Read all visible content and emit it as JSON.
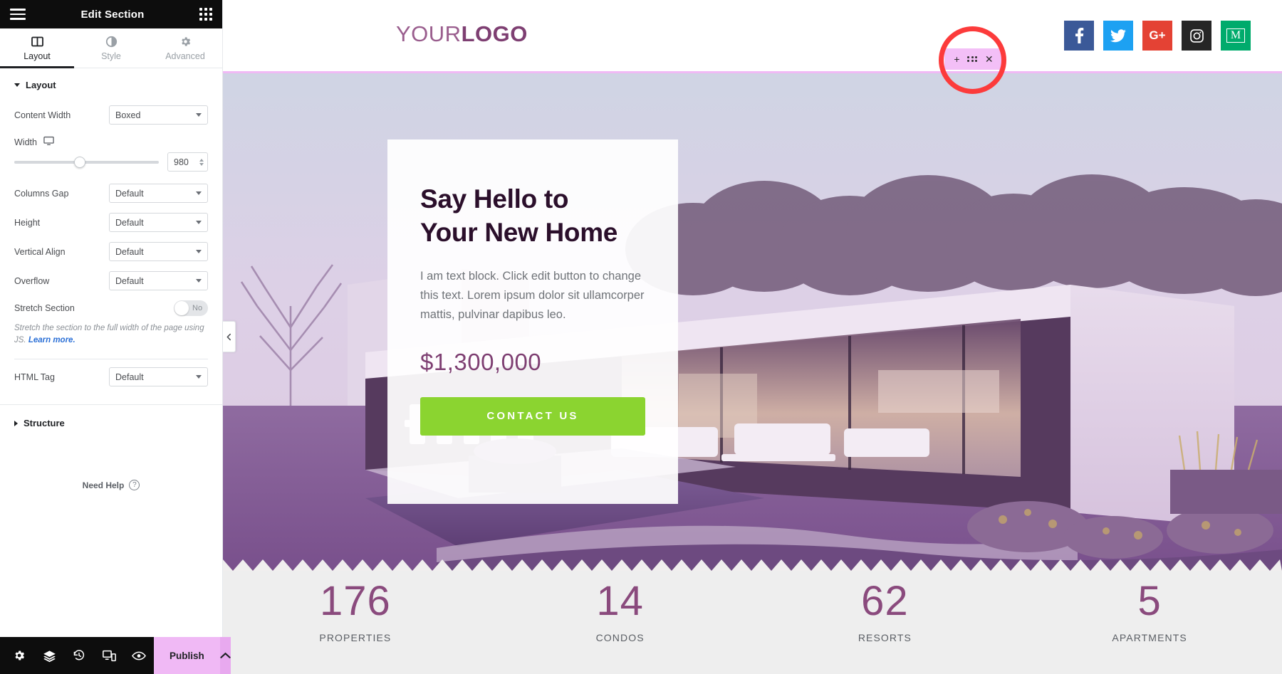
{
  "panel": {
    "header": {
      "title": "Edit Section",
      "menu_icon": "hamburger-icon",
      "widgets_icon": "grid-dots-icon"
    },
    "tabs": [
      {
        "label": "Layout",
        "icon": "layout-columns-icon",
        "active": true
      },
      {
        "label": "Style",
        "icon": "contrast-circle-icon",
        "active": false
      },
      {
        "label": "Advanced",
        "icon": "gear-icon",
        "active": false
      }
    ],
    "sections": {
      "layout": {
        "title": "Layout",
        "expanded": true,
        "controls": [
          {
            "label": "Content Width",
            "type": "select",
            "value": "Boxed"
          },
          {
            "label": "Width",
            "type": "slider",
            "value": "980",
            "device_icon": "desktop-icon"
          },
          {
            "label": "Columns Gap",
            "type": "select",
            "value": "Default"
          },
          {
            "label": "Height",
            "type": "select",
            "value": "Default"
          },
          {
            "label": "Vertical Align",
            "type": "select",
            "value": "Default"
          },
          {
            "label": "Overflow",
            "type": "select",
            "value": "Default"
          },
          {
            "label": "Stretch Section",
            "type": "toggle",
            "value": "No"
          },
          {
            "label": "HTML Tag",
            "type": "select",
            "value": "Default"
          }
        ],
        "hint_text": "Stretch the section to the full width of the page using JS. ",
        "hint_link": "Learn more."
      },
      "structure": {
        "title": "Structure",
        "expanded": false
      }
    },
    "need_help": {
      "label": "Need Help",
      "icon": "question-circle-icon"
    },
    "footer": {
      "icons": [
        "gear-icon",
        "layers-icon",
        "history-icon",
        "responsive-icon",
        "preview-eye-icon"
      ],
      "publish_label": "Publish",
      "publish_arrow_icon": "chevron-up-icon"
    },
    "collapse_icon": "chevron-left-icon"
  },
  "canvas": {
    "site_header": {
      "logo_light": "YOUR",
      "logo_bold": "LOGO",
      "socials": [
        {
          "name": "facebook-icon",
          "glyph": "f",
          "color": "#3b5998"
        },
        {
          "name": "twitter-icon",
          "glyph": "t",
          "color": "#1da1f2"
        },
        {
          "name": "google-plus-icon",
          "glyph": "G+",
          "color": "#e44234"
        },
        {
          "name": "instagram-icon",
          "glyph": "ig",
          "color": "#262626"
        },
        {
          "name": "medium-icon",
          "glyph": "M",
          "color": "#00ab6c"
        }
      ]
    },
    "section_handle": {
      "add_icon": "plus-icon",
      "drag_icon": "drag-dots-icon",
      "close_icon": "close-x-icon",
      "background": "#f3bff7"
    },
    "hero": {
      "heading_line1": "Say Hello to",
      "heading_line2": "Your New Home",
      "paragraph": "I am text block. Click edit button to change this text. Lorem ipsum dolor sit ullamcorper mattis, pulvinar dapibus leo.",
      "price": "$1,300,000",
      "button_label": "CONTACT US",
      "button_color": "#8bd430",
      "accent_color": "#7e3f72"
    },
    "stats": [
      {
        "number": "176",
        "label": "PROPERTIES"
      },
      {
        "number": "14",
        "label": "CONDOS"
      },
      {
        "number": "62",
        "label": "RESORTS"
      },
      {
        "number": "5",
        "label": "APARTMENTS"
      }
    ]
  }
}
